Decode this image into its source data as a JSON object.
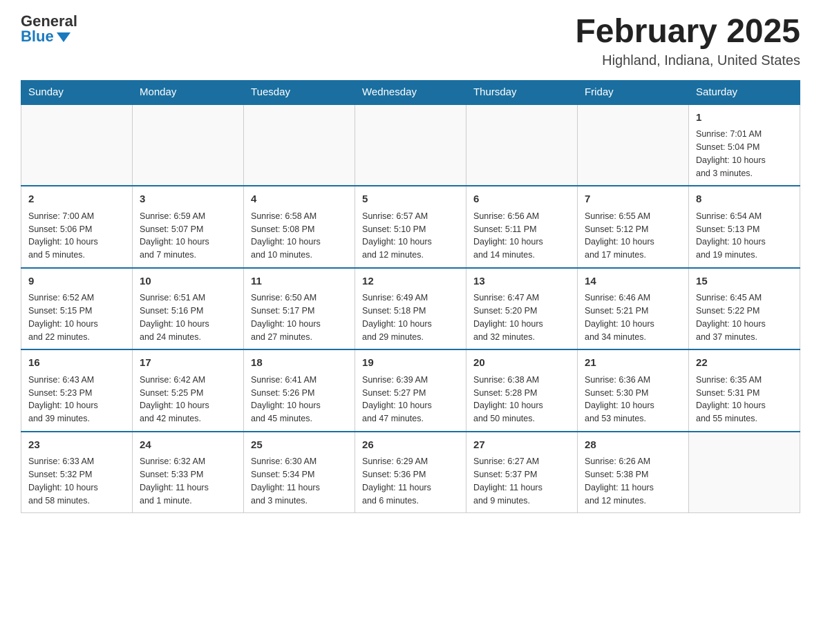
{
  "logo": {
    "general": "General",
    "blue": "Blue"
  },
  "title": "February 2025",
  "location": "Highland, Indiana, United States",
  "days_header": [
    "Sunday",
    "Monday",
    "Tuesday",
    "Wednesday",
    "Thursday",
    "Friday",
    "Saturday"
  ],
  "weeks": [
    [
      {
        "day": "",
        "info": ""
      },
      {
        "day": "",
        "info": ""
      },
      {
        "day": "",
        "info": ""
      },
      {
        "day": "",
        "info": ""
      },
      {
        "day": "",
        "info": ""
      },
      {
        "day": "",
        "info": ""
      },
      {
        "day": "1",
        "info": "Sunrise: 7:01 AM\nSunset: 5:04 PM\nDaylight: 10 hours\nand 3 minutes."
      }
    ],
    [
      {
        "day": "2",
        "info": "Sunrise: 7:00 AM\nSunset: 5:06 PM\nDaylight: 10 hours\nand 5 minutes."
      },
      {
        "day": "3",
        "info": "Sunrise: 6:59 AM\nSunset: 5:07 PM\nDaylight: 10 hours\nand 7 minutes."
      },
      {
        "day": "4",
        "info": "Sunrise: 6:58 AM\nSunset: 5:08 PM\nDaylight: 10 hours\nand 10 minutes."
      },
      {
        "day": "5",
        "info": "Sunrise: 6:57 AM\nSunset: 5:10 PM\nDaylight: 10 hours\nand 12 minutes."
      },
      {
        "day": "6",
        "info": "Sunrise: 6:56 AM\nSunset: 5:11 PM\nDaylight: 10 hours\nand 14 minutes."
      },
      {
        "day": "7",
        "info": "Sunrise: 6:55 AM\nSunset: 5:12 PM\nDaylight: 10 hours\nand 17 minutes."
      },
      {
        "day": "8",
        "info": "Sunrise: 6:54 AM\nSunset: 5:13 PM\nDaylight: 10 hours\nand 19 minutes."
      }
    ],
    [
      {
        "day": "9",
        "info": "Sunrise: 6:52 AM\nSunset: 5:15 PM\nDaylight: 10 hours\nand 22 minutes."
      },
      {
        "day": "10",
        "info": "Sunrise: 6:51 AM\nSunset: 5:16 PM\nDaylight: 10 hours\nand 24 minutes."
      },
      {
        "day": "11",
        "info": "Sunrise: 6:50 AM\nSunset: 5:17 PM\nDaylight: 10 hours\nand 27 minutes."
      },
      {
        "day": "12",
        "info": "Sunrise: 6:49 AM\nSunset: 5:18 PM\nDaylight: 10 hours\nand 29 minutes."
      },
      {
        "day": "13",
        "info": "Sunrise: 6:47 AM\nSunset: 5:20 PM\nDaylight: 10 hours\nand 32 minutes."
      },
      {
        "day": "14",
        "info": "Sunrise: 6:46 AM\nSunset: 5:21 PM\nDaylight: 10 hours\nand 34 minutes."
      },
      {
        "day": "15",
        "info": "Sunrise: 6:45 AM\nSunset: 5:22 PM\nDaylight: 10 hours\nand 37 minutes."
      }
    ],
    [
      {
        "day": "16",
        "info": "Sunrise: 6:43 AM\nSunset: 5:23 PM\nDaylight: 10 hours\nand 39 minutes."
      },
      {
        "day": "17",
        "info": "Sunrise: 6:42 AM\nSunset: 5:25 PM\nDaylight: 10 hours\nand 42 minutes."
      },
      {
        "day": "18",
        "info": "Sunrise: 6:41 AM\nSunset: 5:26 PM\nDaylight: 10 hours\nand 45 minutes."
      },
      {
        "day": "19",
        "info": "Sunrise: 6:39 AM\nSunset: 5:27 PM\nDaylight: 10 hours\nand 47 minutes."
      },
      {
        "day": "20",
        "info": "Sunrise: 6:38 AM\nSunset: 5:28 PM\nDaylight: 10 hours\nand 50 minutes."
      },
      {
        "day": "21",
        "info": "Sunrise: 6:36 AM\nSunset: 5:30 PM\nDaylight: 10 hours\nand 53 minutes."
      },
      {
        "day": "22",
        "info": "Sunrise: 6:35 AM\nSunset: 5:31 PM\nDaylight: 10 hours\nand 55 minutes."
      }
    ],
    [
      {
        "day": "23",
        "info": "Sunrise: 6:33 AM\nSunset: 5:32 PM\nDaylight: 10 hours\nand 58 minutes."
      },
      {
        "day": "24",
        "info": "Sunrise: 6:32 AM\nSunset: 5:33 PM\nDaylight: 11 hours\nand 1 minute."
      },
      {
        "day": "25",
        "info": "Sunrise: 6:30 AM\nSunset: 5:34 PM\nDaylight: 11 hours\nand 3 minutes."
      },
      {
        "day": "26",
        "info": "Sunrise: 6:29 AM\nSunset: 5:36 PM\nDaylight: 11 hours\nand 6 minutes."
      },
      {
        "day": "27",
        "info": "Sunrise: 6:27 AM\nSunset: 5:37 PM\nDaylight: 11 hours\nand 9 minutes."
      },
      {
        "day": "28",
        "info": "Sunrise: 6:26 AM\nSunset: 5:38 PM\nDaylight: 11 hours\nand 12 minutes."
      },
      {
        "day": "",
        "info": ""
      }
    ]
  ]
}
